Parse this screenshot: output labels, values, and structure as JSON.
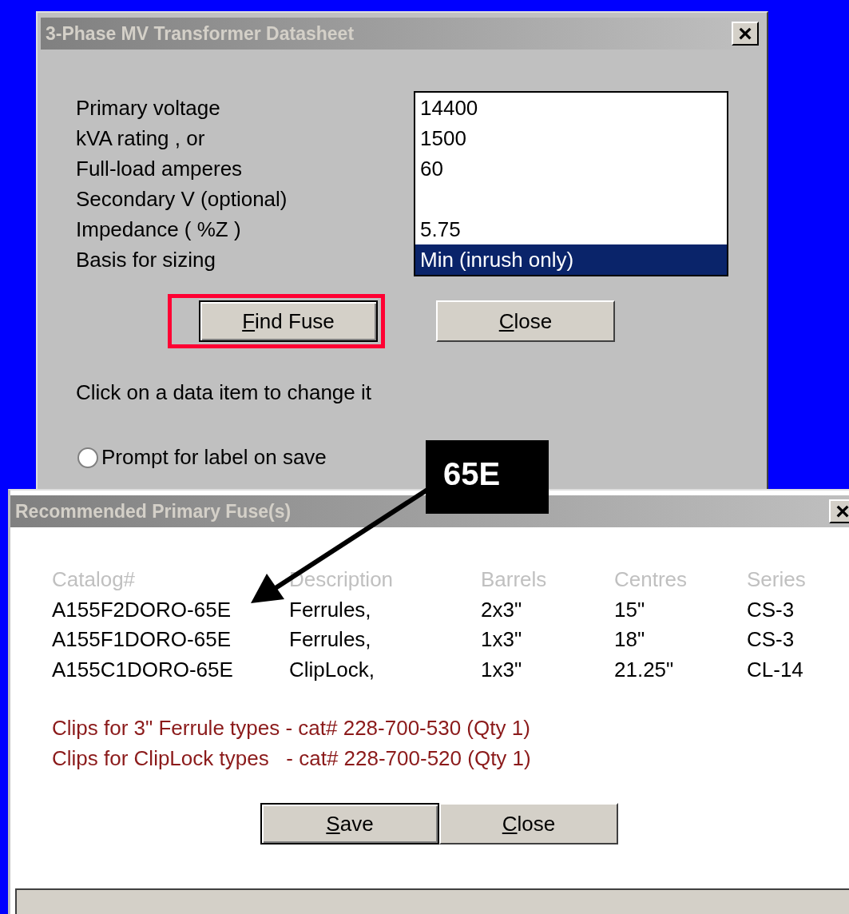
{
  "datasheet_window": {
    "title": "3-Phase MV Transformer Datasheet",
    "close_glyph": "×",
    "fields": [
      {
        "label": "Primary voltage",
        "value": "14400",
        "selected": false
      },
      {
        "label": "kVA rating , or",
        "value": "1500",
        "selected": false
      },
      {
        "label": "Full-load amperes",
        "value": "60",
        "selected": false
      },
      {
        "label": "Secondary V (optional)",
        "selected": false
      },
      {
        "label": "Impedance ( %Z )",
        "value": "5.75",
        "selected": false
      },
      {
        "label": "Basis for sizing",
        "value": "Min (inrush only)",
        "selected": true
      }
    ],
    "buttons": [
      {
        "label": "Find Fuse",
        "highlighted": true,
        "default": true
      },
      {
        "label": "Close",
        "highlighted": false,
        "default": false
      }
    ],
    "hint": "Click on a data item to change it",
    "radio": {
      "label": "Prompt for label on save",
      "checked": false
    }
  },
  "callout": {
    "text": "65E"
  },
  "fuse_window": {
    "title": "Recommended Primary Fuse(s)",
    "close_glyph": "×",
    "table": {
      "columns": [
        "Catalog#",
        "Description",
        "Barrels",
        "Centres",
        "Series"
      ],
      "rows": [
        [
          "A155F2DORO-65E",
          "Ferrules,",
          "2x3\"",
          "15\"",
          "CS-3"
        ],
        [
          "A155F1DORO-65E",
          "Ferrules,",
          "1x3\"",
          "18\"",
          "CS-3"
        ],
        [
          "A155C1DORO-65E",
          "ClipLock,",
          "1x3\"",
          "21.25\"",
          "CL-14"
        ]
      ]
    },
    "notes": [
      "Clips for 3\" Ferrule types - cat# 228-700-530 (Qty 1)",
      "Clips for ClipLock types   - cat# 228-700-520 (Qty 1)"
    ],
    "buttons": [
      {
        "label": "Save",
        "default": true
      },
      {
        "label": "Close",
        "default": false
      }
    ]
  }
}
